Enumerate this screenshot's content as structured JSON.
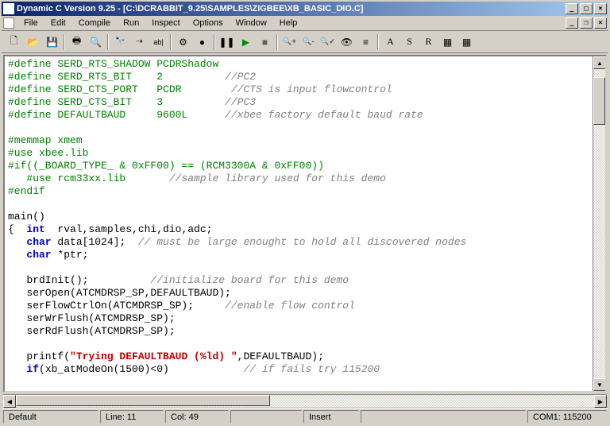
{
  "title": "Dynamic C Version 9.25 - [C:\\DCRABBIT_9.25\\SAMPLES\\ZIGBEE\\XB_BASIC_DIO.C]",
  "menu": [
    "File",
    "Edit",
    "Compile",
    "Run",
    "Inspect",
    "Options",
    "Window",
    "Help"
  ],
  "toolbar": {
    "new": "new",
    "open": "open",
    "save": "save",
    "print": "print",
    "preview": "preview",
    "find": "find",
    "findnext": "findnext",
    "replace": "replace",
    "toggle_bp": "toggle-bp",
    "clear_bp": "clear-bp",
    "pause": "pause",
    "run": "run",
    "stop": "stop",
    "zoomin": "zoom+",
    "zoomout": "zoom-",
    "zoomreset": "zoomr",
    "asm": "asm",
    "reg": "reg",
    "stdio": "stdio",
    "a": "A",
    "s": "S",
    "r": "R",
    "g1": "grid1",
    "g2": "grid2"
  },
  "code": {
    "l1": {
      "pp": "#define SERD_RTS_SHADOW PCDRShadow"
    },
    "l2": {
      "pp": "#define SERD_RTS_BIT    2          ",
      "cm": "//PC2"
    },
    "l3": {
      "pp": "#define SERD_CTS_PORT   PCDR        ",
      "cm": "//CTS is input flowcontrol"
    },
    "l4": {
      "pp": "#define SERD_CTS_BIT    3          ",
      "cm": "//PC3"
    },
    "l5": {
      "pp": "#define DEFAULTBAUD     9600L      ",
      "cm": "//xbee factory default baud rate"
    },
    "l7": {
      "pp": "#memmap xmem"
    },
    "l8": {
      "pp": "#use xbee.lib"
    },
    "l9": {
      "pp": "#if((_BOARD_TYPE_ & 0xFF00) == (RCM3300A & 0xFF00))"
    },
    "l10a": {
      "t": "   ",
      "pp": "#use rcm33xx.lib       ",
      "cm": "//sample library used for this demo"
    },
    "l11": {
      "pp": "#endif"
    },
    "l13": {
      "t": "main()"
    },
    "l14": {
      "t1": "{  ",
      "kw1": "int",
      "t2": "  rval,samples,chi,dio,adc;"
    },
    "l15": {
      "t1": "   ",
      "kw1": "char",
      "t2": " data[1024];  ",
      "cm": "// must be large enought to hold all discovered nodes"
    },
    "l16": {
      "t1": "   ",
      "kw1": "char",
      "t2": " *ptr;"
    },
    "l18": {
      "t1": "   brdInit();          ",
      "cm": "//initialize board for this demo"
    },
    "l19": {
      "t": "   serOpen(ATCMDRSP_SP,DEFAULTBAUD);"
    },
    "l20": {
      "t1": "   serFlowCtrlOn(ATCMDRSP_SP);     ",
      "cm": "//enable flow control"
    },
    "l21": {
      "t": "   serWrFlush(ATCMDRSP_SP);"
    },
    "l22": {
      "t": "   serRdFlush(ATCMDRSP_SP);"
    },
    "l24": {
      "t1": "   printf(",
      "st": "\"Trying DEFAULTBAUD (%ld) \"",
      "t2": ",DEFAULTBAUD);"
    },
    "l25": {
      "t1": "   ",
      "kw1": "if",
      "t2": "(xb_atModeOn(1500)<0)            ",
      "cm": "// if fails try 115200"
    }
  },
  "status": {
    "mode": "Default",
    "line": "Line: 11",
    "col": "Col: 49",
    "insert": "Insert",
    "com": "COM1: 115200"
  }
}
